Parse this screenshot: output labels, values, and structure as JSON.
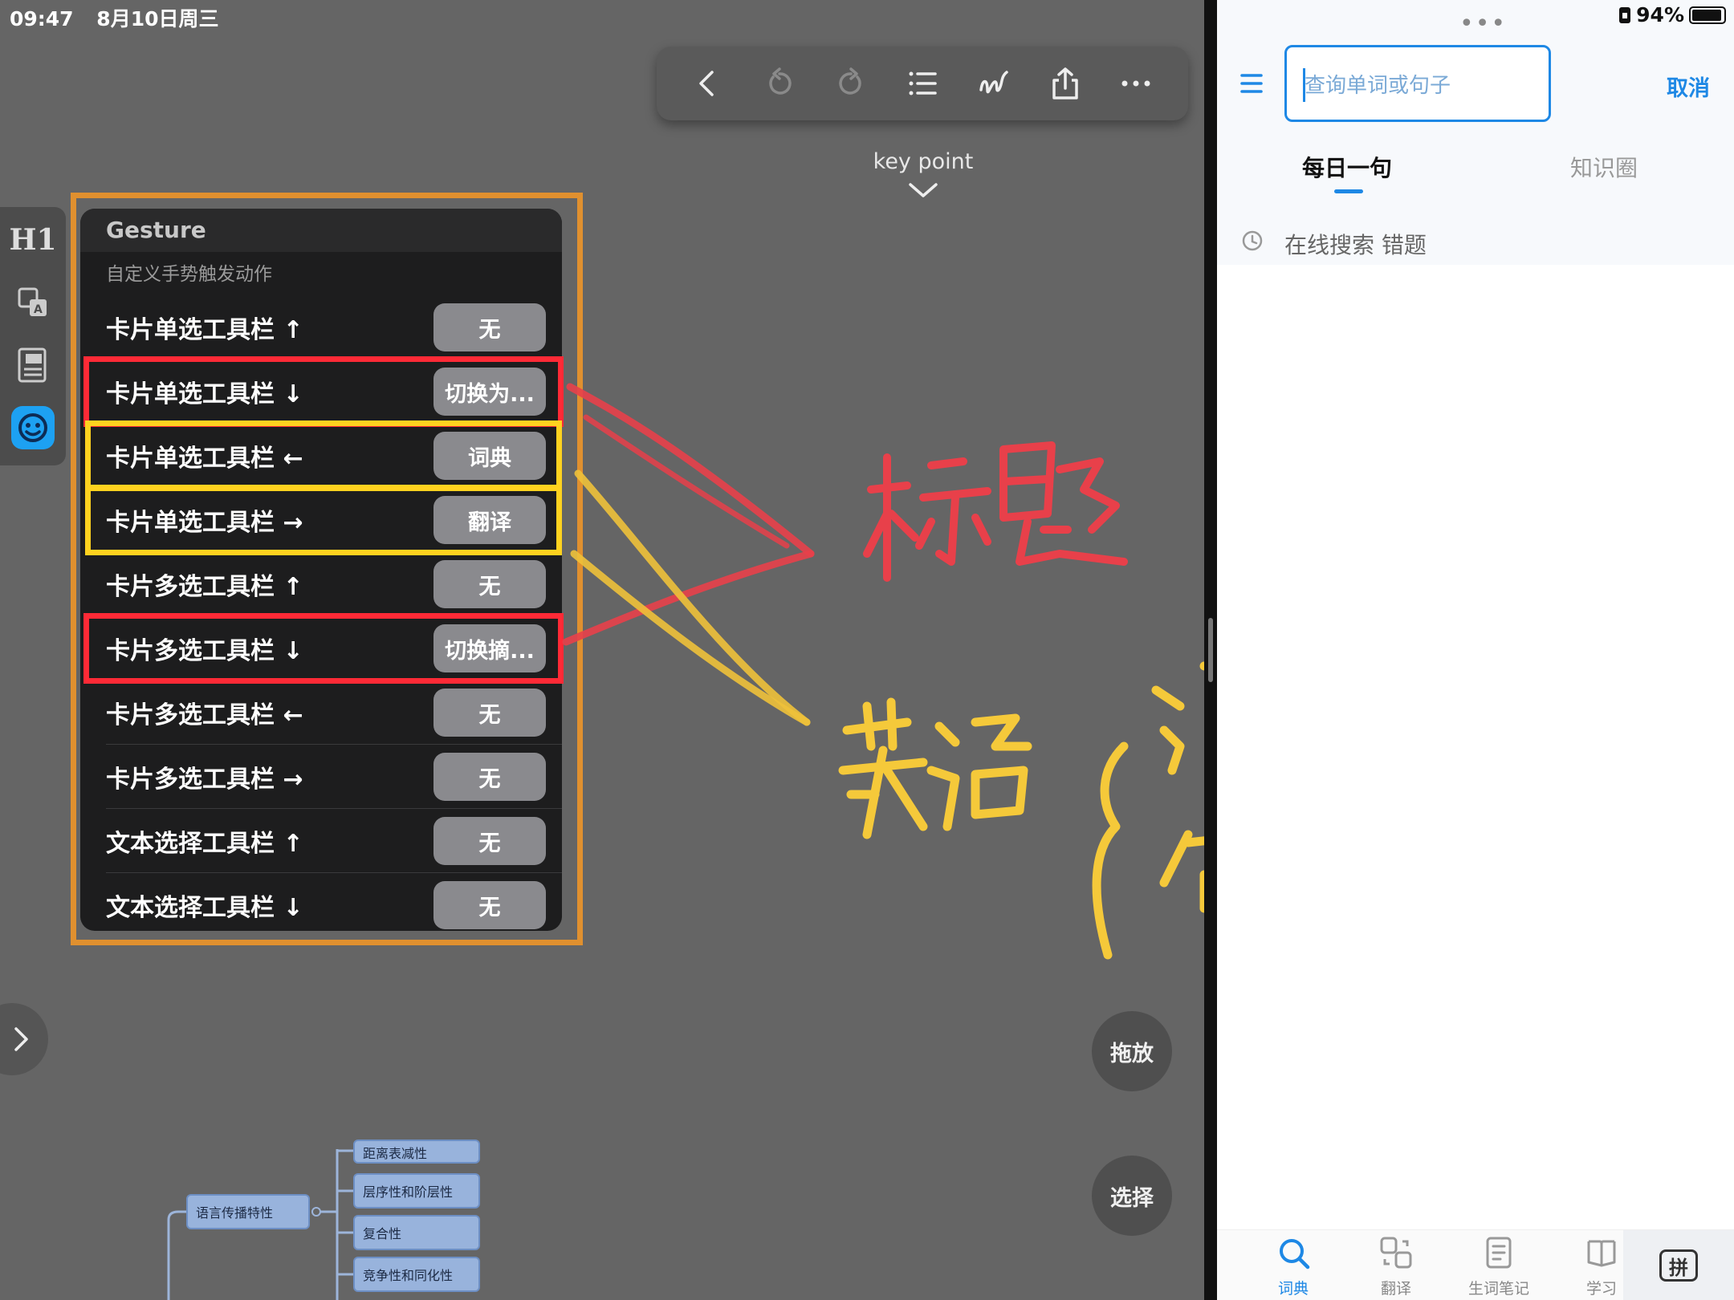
{
  "status_bar": {
    "time": "09:47",
    "date": "8月10日周三",
    "battery": "94%"
  },
  "toolbar": {
    "icons": [
      "back-icon",
      "undo-icon",
      "redo-icon",
      "list-icon",
      "pen-icon",
      "share-icon",
      "more-icon"
    ]
  },
  "outline": {
    "key_point": "key point"
  },
  "dock": {
    "h1_label": "H1"
  },
  "gesture_panel": {
    "title": "Gesture",
    "subtitle": "自定义手势触发动作",
    "rows": [
      {
        "label": "卡片单选工具栏 ↑",
        "value": "无",
        "highlight": "none"
      },
      {
        "label": "卡片单选工具栏 ↓",
        "value": "切换为...",
        "highlight": "red"
      },
      {
        "label": "卡片单选工具栏 ←",
        "value": "词典",
        "highlight": "yellow"
      },
      {
        "label": "卡片单选工具栏 →",
        "value": "翻译",
        "highlight": "yellow"
      },
      {
        "label": "卡片多选工具栏 ↑",
        "value": "无",
        "highlight": "none"
      },
      {
        "label": "卡片多选工具栏 ↓",
        "value": "切换摘...",
        "highlight": "red"
      },
      {
        "label": "卡片多选工具栏 ←",
        "value": "无",
        "highlight": "none"
      },
      {
        "label": "卡片多选工具栏 →",
        "value": "无",
        "highlight": "none"
      },
      {
        "label": "文本选择工具栏 ↑",
        "value": "无",
        "highlight": "none"
      },
      {
        "label": "文本选择工具栏 ↓",
        "value": "无",
        "highlight": "none"
      }
    ],
    "colors": {
      "outline": "#e0902f",
      "red": "#ff2a36",
      "yellow": "#ffd21f"
    }
  },
  "handwriting": {
    "red_text": "标题",
    "yellow_text_main": "英语",
    "yellow_text_branch_1": "词",
    "yellow_text_branch_2": "句"
  },
  "mind_map": {
    "root": "语言传播特性",
    "children": [
      "距离表减性",
      "层序性和阶层性",
      "复合性",
      "竞争性和同化性"
    ]
  },
  "float_buttons": {
    "drag": "拖放",
    "select": "选择"
  },
  "dictionary_app": {
    "search_placeholder": "查询单词或句子",
    "cancel": "取消",
    "tabs": [
      "每日一句",
      "知识圈"
    ],
    "history": "在线搜索 错题",
    "nav": [
      "词典",
      "翻译",
      "生词笔记",
      "学习"
    ],
    "pin_label": "拼",
    "accent": "#1e88e5"
  }
}
